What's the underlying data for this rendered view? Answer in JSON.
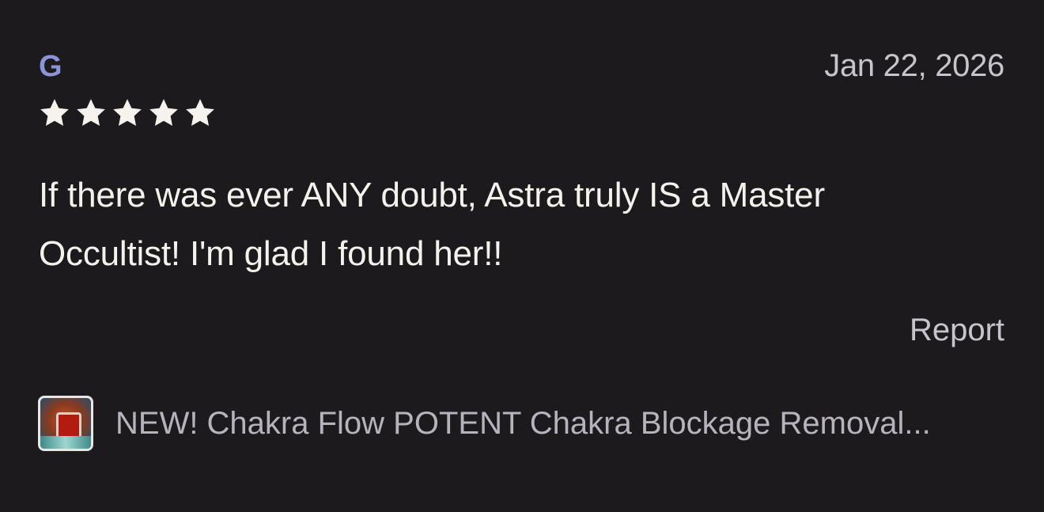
{
  "review": {
    "author": "G",
    "date": "Jan 22, 2026",
    "rating": 5,
    "rating_max": 5,
    "text": "If there was ever ANY doubt, Astra truly IS a Master Occultist! I'm glad I found her!!",
    "report_label": "Report"
  },
  "product": {
    "title": "NEW! Chakra Flow POTENT Chakra Blockage Removal..."
  },
  "icons": {
    "star": "star-icon",
    "thumbnail": "product-thumbnail"
  },
  "colors": {
    "background": "#1c1a1d",
    "author": "#8b95d6",
    "star": "#f6f3ee",
    "text": "#f5f2ee",
    "muted": "#c9c4cc"
  }
}
